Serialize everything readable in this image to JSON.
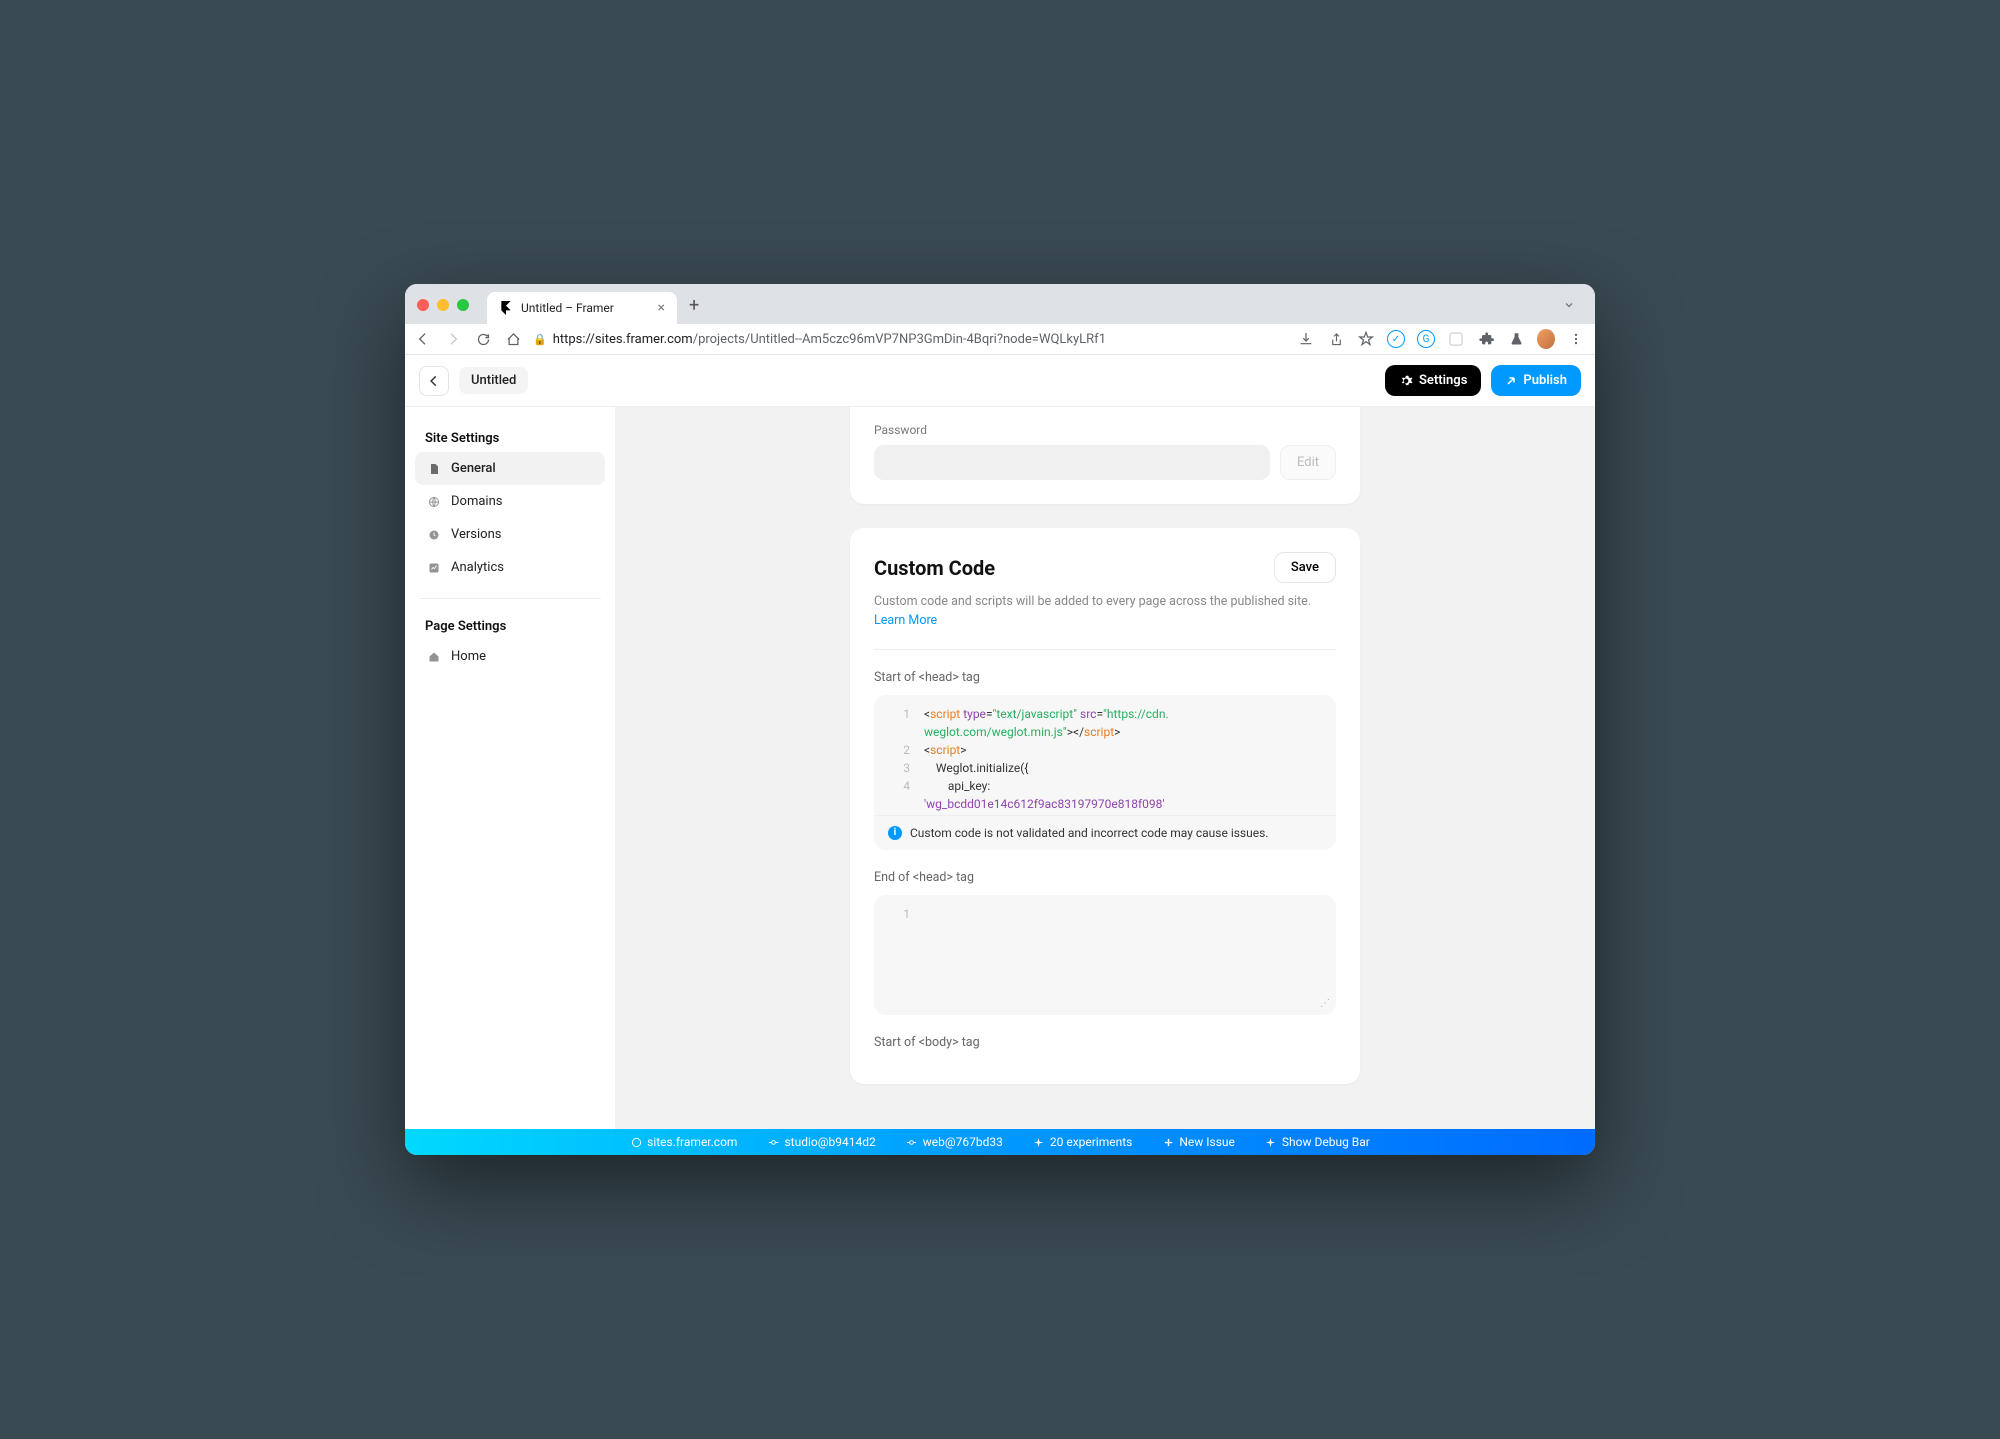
{
  "browser": {
    "tab_title": "Untitled – Framer",
    "url_domain": "https://sites.framer.com",
    "url_path": "/projects/Untitled--Am5czc96mVP7NP3GmDin-4Bqri?node=WQLkyLRf1"
  },
  "header": {
    "page_title": "Untitled",
    "settings_label": "Settings",
    "publish_label": "Publish"
  },
  "sidebar": {
    "site_heading": "Site Settings",
    "page_heading": "Page Settings",
    "items": {
      "general": "General",
      "domains": "Domains",
      "versions": "Versions",
      "analytics": "Analytics",
      "home": "Home"
    }
  },
  "password_card": {
    "label": "Password",
    "edit": "Edit"
  },
  "custom_code": {
    "title": "Custom Code",
    "save": "Save",
    "description_text": "Custom code and scripts will be added to every page across the published site. ",
    "description_link": "Learn More",
    "start_head_label": "Start of <head> tag",
    "end_head_label": "End of <head> tag",
    "start_body_label": "Start of <body> tag",
    "warning": "Custom code is not validated and incorrect code may cause issues.",
    "code_lines": {
      "l1_a": "script",
      "l1_b": "type",
      "l1_c": "\"text/javascript\"",
      "l1_d": "src",
      "l1_e": "\"https://cdn.",
      "l1_cont": "weglot.com/weglot.min.js\"",
      "l1_close": "script",
      "l2": "script",
      "l3": "    Weglot.initialize({",
      "l4": "        api_key:",
      "l4b": "'wg_bcdd01e14c612f9ac83197970e818f098'",
      "l5": "    });"
    }
  },
  "debug_bar": {
    "site": "sites.framer.com",
    "studio": "studio@b9414d2",
    "web": "web@767bd33",
    "experiments": "20 experiments",
    "new_issue": "New Issue",
    "show_debug": "Show Debug Bar"
  }
}
